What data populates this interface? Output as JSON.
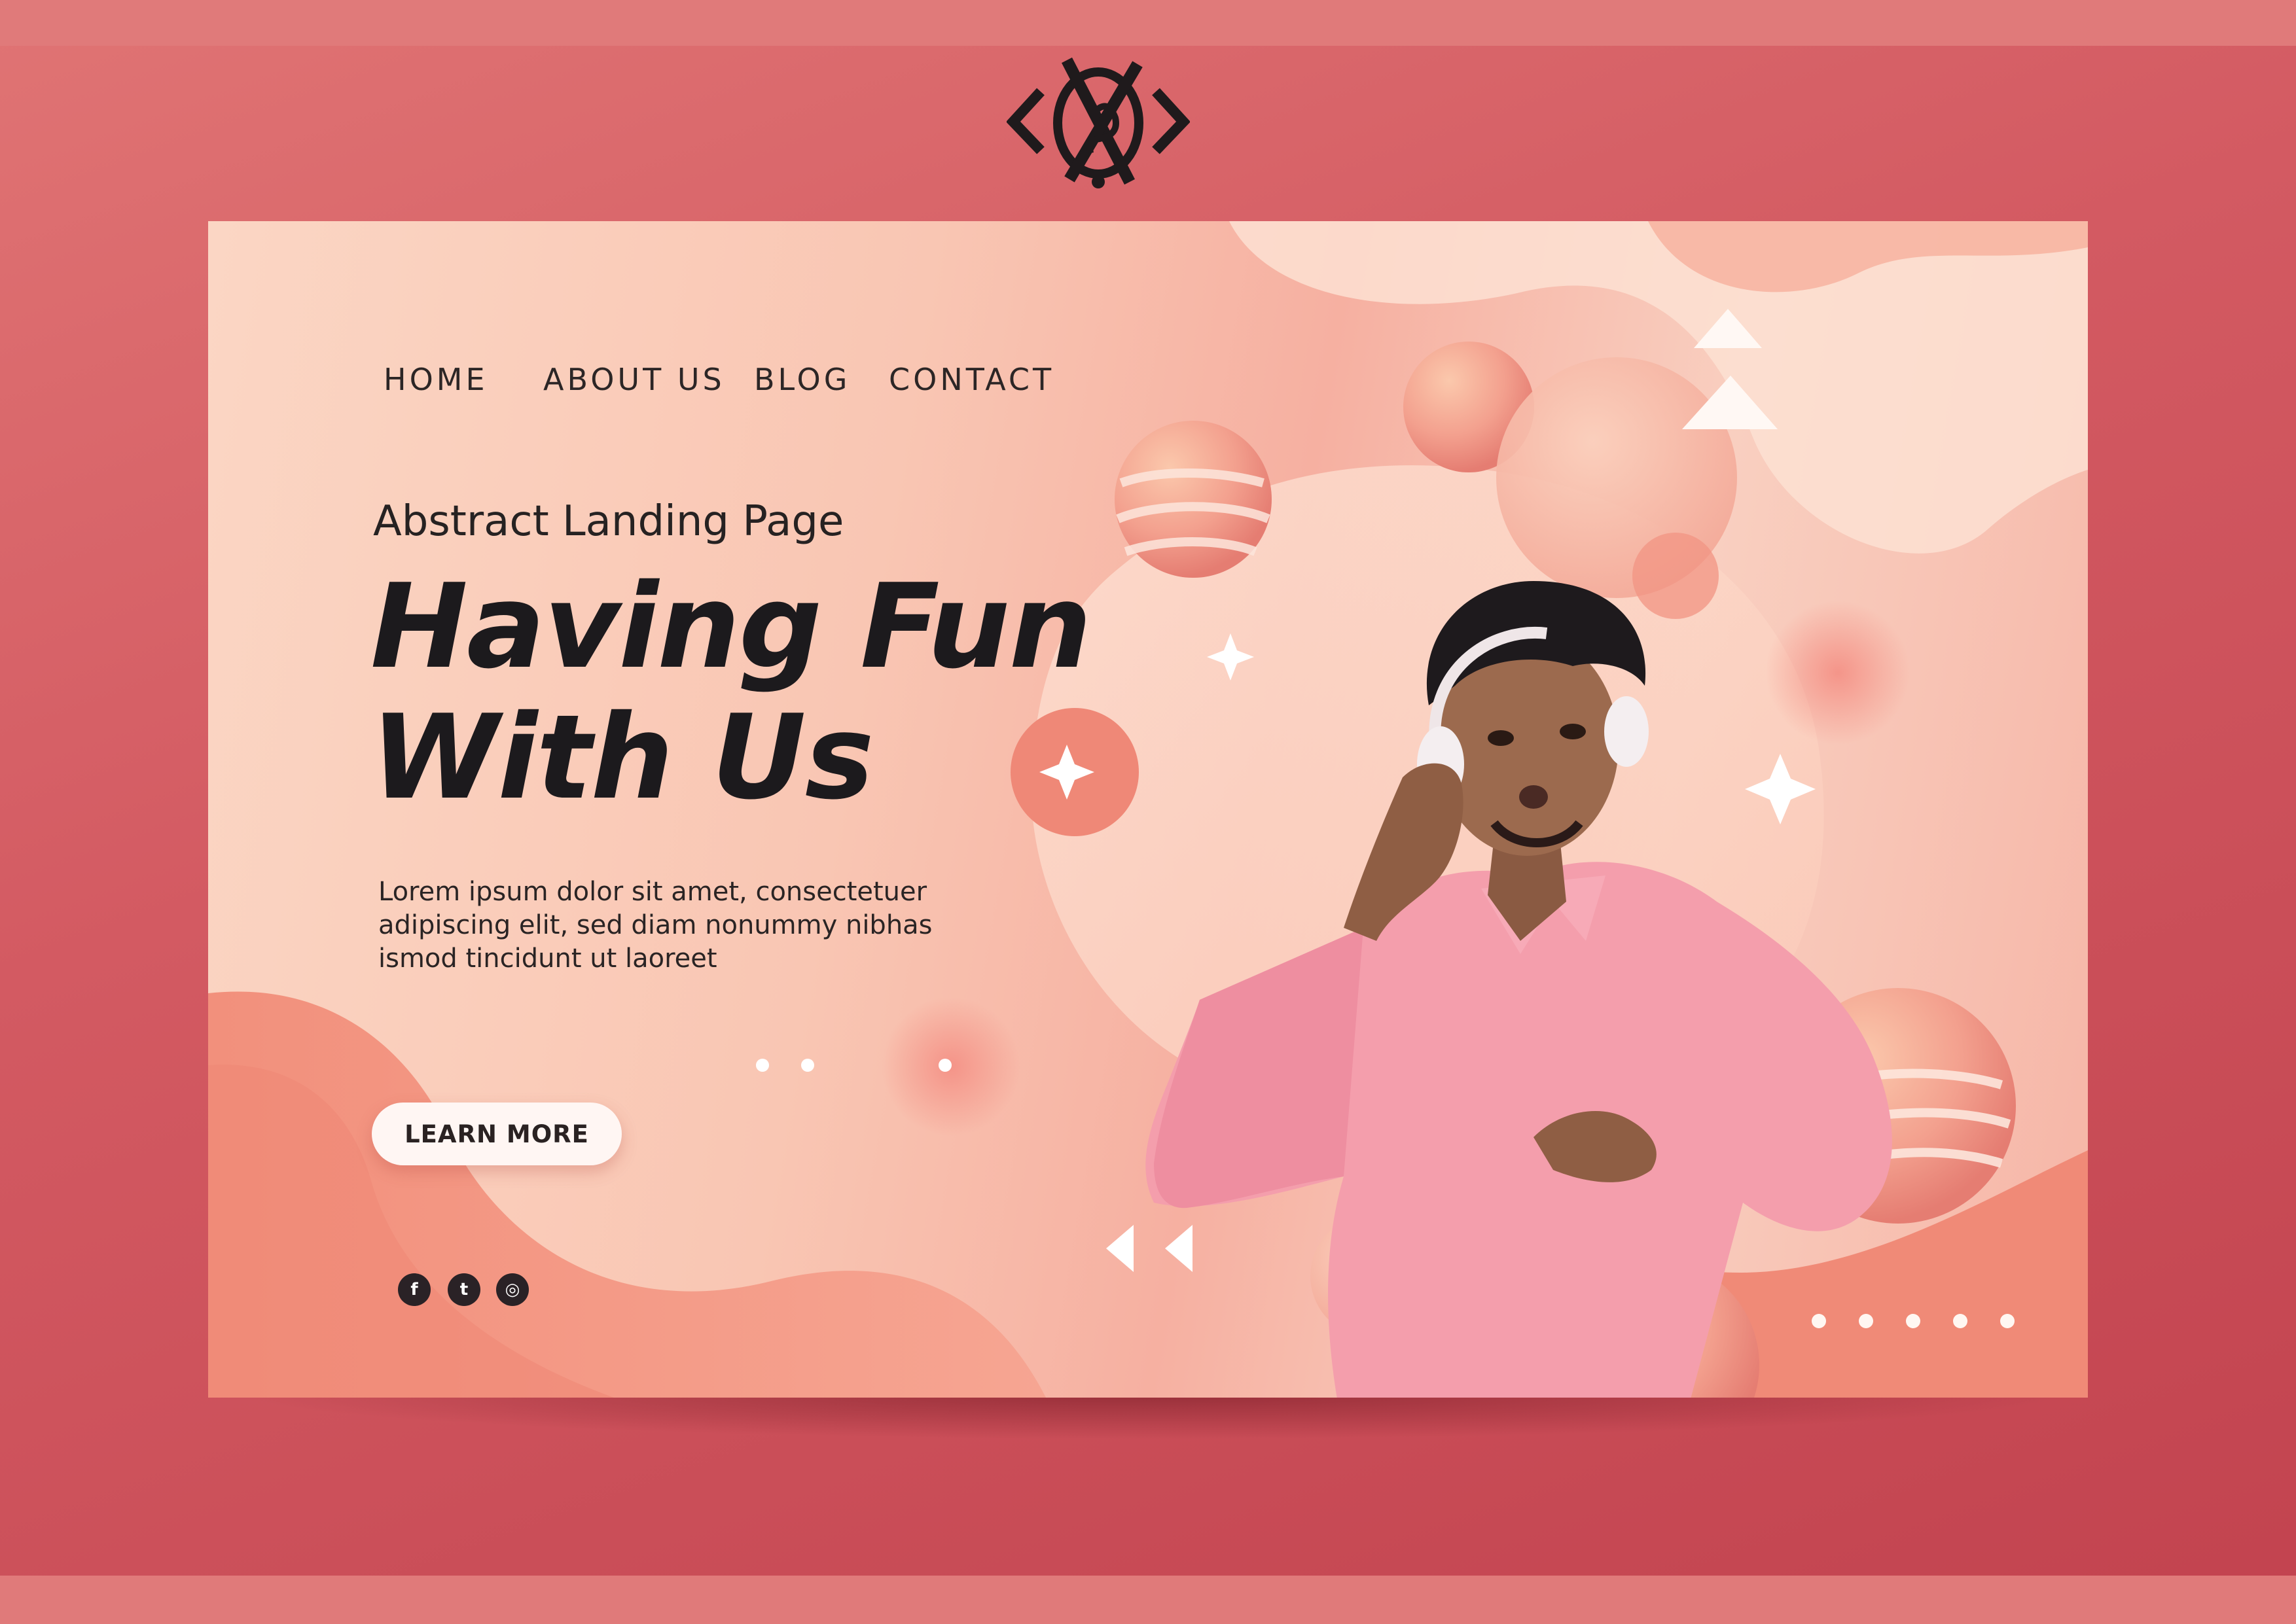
{
  "logo": {
    "label": "logo-mark"
  },
  "nav": {
    "items": [
      {
        "label": "HOME"
      },
      {
        "label": "ABOUT US"
      },
      {
        "label": "BLOG"
      },
      {
        "label": "CONTACT"
      }
    ]
  },
  "hero": {
    "subtitle": "Abstract Landing Page",
    "headline_line1": "Having Fun",
    "headline_line2": "With Us",
    "body_lines": [
      "Lorem ipsum dolor sit amet, consectetuer",
      "adipiscing elit, sed diam nonummy nibhas",
      "ismod tincidunt ut laoreet"
    ],
    "cta_label": "LEARN MORE"
  },
  "social": [
    {
      "icon": "facebook-icon",
      "glyph": "f"
    },
    {
      "icon": "twitter-icon",
      "glyph": "t"
    },
    {
      "icon": "instagram-icon",
      "glyph": "◎"
    }
  ],
  "carousel": {
    "dot_count": 5
  },
  "colors": {
    "frame": "#d35a62",
    "band": "#e07a7a",
    "card_light": "#fbd6c4",
    "accent_coral": "#f08d80",
    "text_dark": "#1c1a1d"
  }
}
